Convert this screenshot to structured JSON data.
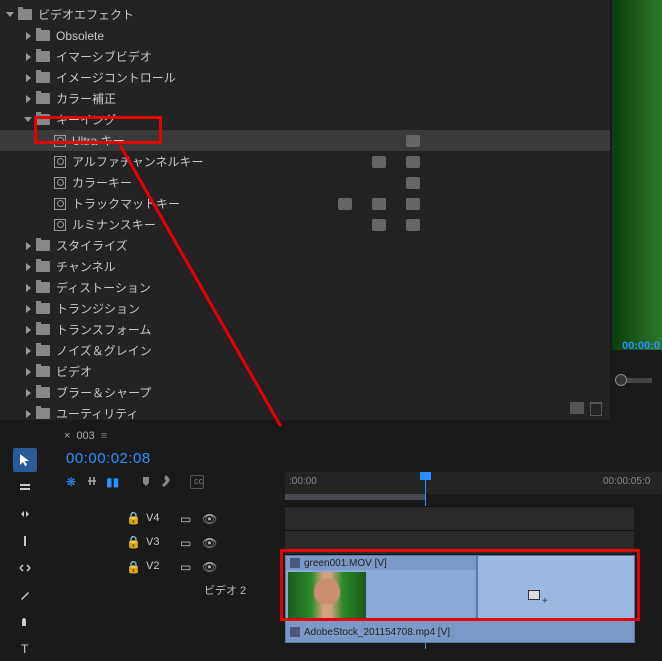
{
  "effects": {
    "root": "ビデオエフェクト",
    "obsolete": "Obsolete",
    "immersive": "イマーシブビデオ",
    "imagecontrol": "イメージコントロール",
    "colorcorrect": "カラー補正",
    "keying": "キーイング",
    "ultrakey": "Ultra キー",
    "alphachannel": "アルファチャンネルキー",
    "colorkey": "カラーキー",
    "trackmatte": "トラックマットキー",
    "luminance": "ルミナンスキー",
    "stylize": "スタイライズ",
    "channel": "チャンネル",
    "distortion": "ディストーション",
    "transition": "トランジション",
    "transform": "トランスフォーム",
    "noise": "ノイズ＆グレイン",
    "video": "ビデオ",
    "blur": "ブラー＆シャープ",
    "utility": "ユーティリティ"
  },
  "preview": {
    "timecode": "00:00:0"
  },
  "sequence": {
    "name": "003",
    "playhead_tc": "00:00:02:08",
    "ruler_start": ":00:00",
    "ruler_next": "00:00:05:0"
  },
  "tracks": {
    "v4": "V4",
    "v3": "V3",
    "v2": "V2",
    "v2_label": "ビデオ 2"
  },
  "clips": {
    "green": "green001.MOV [V]",
    "stock": "AdobeStock_201154708.mp4 [V]"
  }
}
